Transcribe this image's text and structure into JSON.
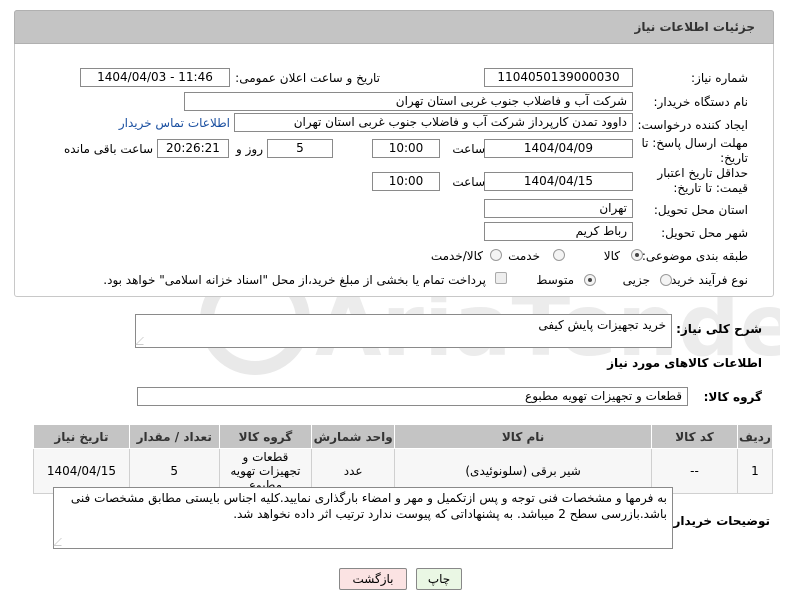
{
  "header": {
    "title": "جزئیات اطلاعات نیاز"
  },
  "form": {
    "need_number_label": "شماره نیاز:",
    "need_number": "1104050139000030",
    "announce_label": "تاریخ و ساعت اعلان عمومی:",
    "announce_value": "1404/04/03 - 11:46",
    "buyer_org_label": "نام دستگاه خریدار:",
    "buyer_org": "شرکت آب و فاضلاب جنوب غربی استان تهران",
    "creator_label": "ایجاد کننده درخواست:",
    "creator": "داوود  تمدن  کارپرداز شرکت آب و فاضلاب جنوب غربی استان تهران",
    "buyer_contact_link": "اطلاعات تماس خریدار",
    "deadline_label": "مهلت ارسال پاسخ: تا تاریخ:",
    "deadline_date": "1404/04/09",
    "time_label": "ساعت",
    "deadline_time": "10:00",
    "days_value": "5",
    "days_label": "روز و",
    "remaining_time": "20:26:21",
    "remaining_label": "ساعت باقی مانده",
    "price_validity_label": "حداقل تاریخ اعتبار قیمت: تا تاریخ:",
    "price_validity_date": "1404/04/15",
    "price_validity_time": "10:00",
    "province_label": "استان محل تحویل:",
    "province": "تهران",
    "city_label": "شهر محل تحویل:",
    "city": "رباط کریم",
    "category_label": "طبقه بندی موضوعی:",
    "category_options": [
      "کالا",
      "خدمت",
      "کالا/خدمت"
    ],
    "process_label": "نوع فرآیند خرید :",
    "process_options": [
      "جزیی",
      "متوسط"
    ],
    "payment_note": "پرداخت تمام یا بخشی از مبلغ خرید،از محل \"اسناد خزانه اسلامی\" خواهد بود."
  },
  "description": {
    "label": "شرح کلی نیاز:",
    "value": "خرید تجهیزات پایش کیفی"
  },
  "goods_info": {
    "title": "اطلاعات کالاهای مورد نیاز",
    "group_label": "گروه کالا:",
    "group_value": "قطعات و تجهیزات تهویه مطبوع"
  },
  "table": {
    "headers": [
      "ردیف",
      "کد کالا",
      "نام کالا",
      "واحد شمارش",
      "گروه کالا",
      "تعداد / مقدار",
      "تاریخ نیاز"
    ],
    "rows": [
      [
        "1",
        "--",
        "شیر برقی (سلونوئیدی)",
        "عدد",
        "قطعات و تجهیزات تهویه مطبوع",
        "5",
        "1404/04/15"
      ]
    ]
  },
  "buyer_notes": {
    "label": "توضیحات خریدار:",
    "value": "به فرمها و مشخصات فنی توجه و پس ازتکمیل و مهر و امضاء بارگذاری نمایید.کلیه اجناس بایستی مطابق مشخصات فنی باشد.بازرسی سطح 2 میباشد. به پشنهاداتی که پیوست ندارد ترتیب اثر داده نخواهد شد."
  },
  "buttons": {
    "print": "چاپ",
    "back": "بازگشت"
  },
  "colors": {
    "header_bg": "#c4c4c4",
    "link": "#1a4fa0",
    "print_btn": "#eaf7e4",
    "back_btn": "#fbe3e3"
  }
}
